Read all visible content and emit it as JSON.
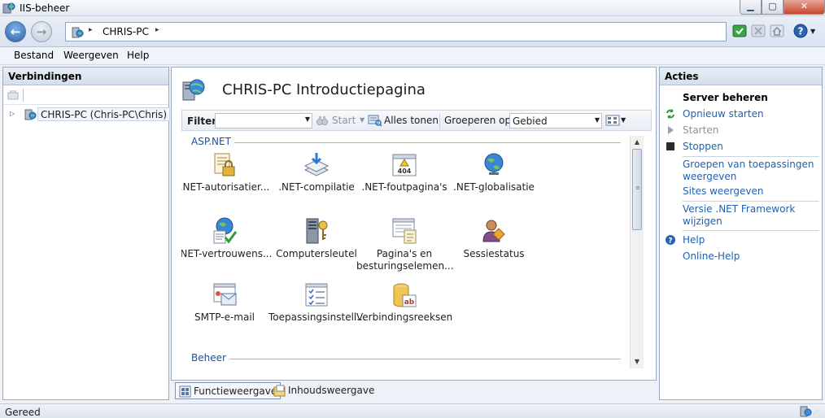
{
  "window": {
    "title": "IIS-beheer"
  },
  "address": {
    "crumb": "CHRIS-PC",
    "arrow": "▸"
  },
  "menu": {
    "file": "Bestand",
    "view": "Weergeven",
    "help": "Help"
  },
  "connections": {
    "title": "Verbindingen",
    "tree_item": "CHRIS-PC (Chris-PC\\Chris)"
  },
  "main": {
    "title": "CHRIS-PC Introductiepagina",
    "filter_label": "Filter:",
    "filter_value": "",
    "start_label": "Start",
    "show_all_label": "Alles tonen",
    "group_by_label": "Groeperen op:",
    "group_by_value": "Gebied",
    "groups": [
      {
        "name": "ASP.NET",
        "features": [
          {
            "label": ".NET-autorisatier...",
            "icon": "lock-document-icon"
          },
          {
            "label": ".NET-compilatie",
            "icon": "stack-download-icon"
          },
          {
            "label": ".NET-foutpagina's",
            "icon": "error-page-404-icon",
            "badge": "404"
          },
          {
            "label": ".NET-globalisatie",
            "icon": "globe-icon"
          },
          {
            "label": ".NET-vertrouwens...",
            "icon": "trust-globe-icon"
          },
          {
            "label": "Computersleutel",
            "icon": "machine-key-icon"
          },
          {
            "label": "Pagina's en besturingselemen...",
            "icon": "pages-controls-icon"
          },
          {
            "label": "Sessiestatus",
            "icon": "session-state-icon"
          },
          {
            "label": "SMTP-e-mail",
            "icon": "smtp-mail-icon"
          },
          {
            "label": "Toepassingsinstell...",
            "icon": "app-settings-icon"
          },
          {
            "label": "Verbindingsreeksen",
            "icon": "connection-strings-icon",
            "badge": "ab"
          }
        ]
      },
      {
        "name": "Beheer",
        "features": []
      }
    ],
    "tabs": {
      "features_view": "Functieweergave",
      "content_view": "Inhoudsweergave"
    }
  },
  "actions": {
    "title": "Acties",
    "manage_server": "Server beheren",
    "restart": "Opnieuw starten",
    "start": "Starten",
    "stop": "Stoppen",
    "app_pools": "Groepen van toepassingen weergeven",
    "sites": "Sites weergeven",
    "net_version": "Versie .NET Framework wijzigen",
    "help": "Help",
    "online_help": "Online-Help"
  },
  "status": {
    "text": "Gereed"
  },
  "colors": {
    "link": "#2061b3",
    "group_heading": "#1a4f9c",
    "disabled": "#8d949c"
  }
}
